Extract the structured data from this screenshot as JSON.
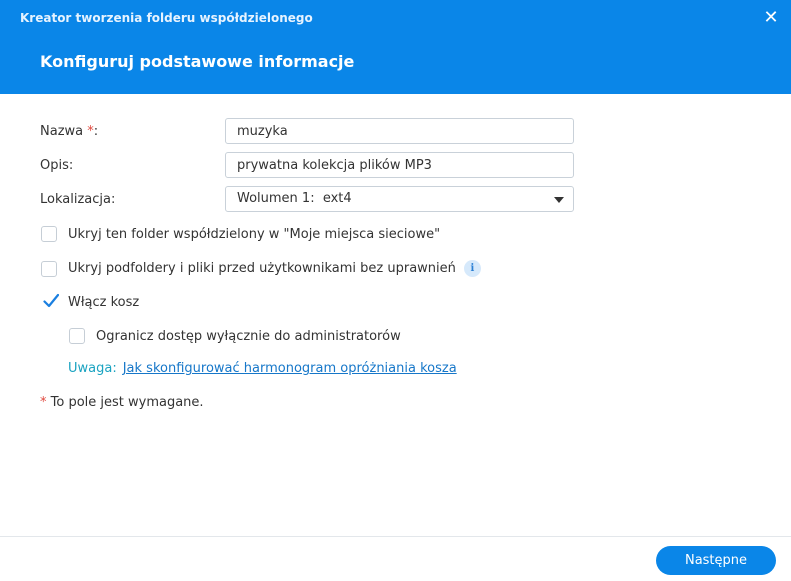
{
  "window": {
    "title": "Kreator tworzenia folderu współdzielonego",
    "close_glyph": "✕"
  },
  "step": {
    "title": "Konfiguruj podstawowe informacje"
  },
  "form": {
    "name_label": "Nazwa ",
    "name_required_mark": "*",
    "name_colon": ":",
    "name_value": "muzyka",
    "description_label": "Opis:",
    "description_value": "prywatna kolekcja plików MP3",
    "location_label": "Lokalizacja:",
    "location_value": "Wolumen 1:  ext4"
  },
  "options": {
    "hide_in_network_places": {
      "label": "Ukryj ten folder współdzielony w \"Moje miejsca sieciowe\"",
      "checked": false
    },
    "hide_subfolders": {
      "label": "Ukryj podfoldery i pliki przed użytkownikami bez uprawnień",
      "checked": false,
      "info_glyph": "i"
    },
    "enable_recycle_bin": {
      "label": "Włącz kosz",
      "checked": true
    },
    "restrict_admin_only": {
      "label": "Ogranicz dostęp wyłącznie do administratorów",
      "checked": false
    }
  },
  "note": {
    "label": "Uwaga:",
    "link_text": "Jak skonfigurować harmonogram opróżniania kosza"
  },
  "required_note": {
    "mark": "*",
    "text": " To pole jest wymagane."
  },
  "footer": {
    "next_label": "Następne"
  },
  "colors": {
    "accent": "#0a86e8",
    "required": "#e0483e",
    "link": "#1677c9",
    "note_label": "#1aa3c1",
    "checkmark": "#1a7fe0"
  }
}
